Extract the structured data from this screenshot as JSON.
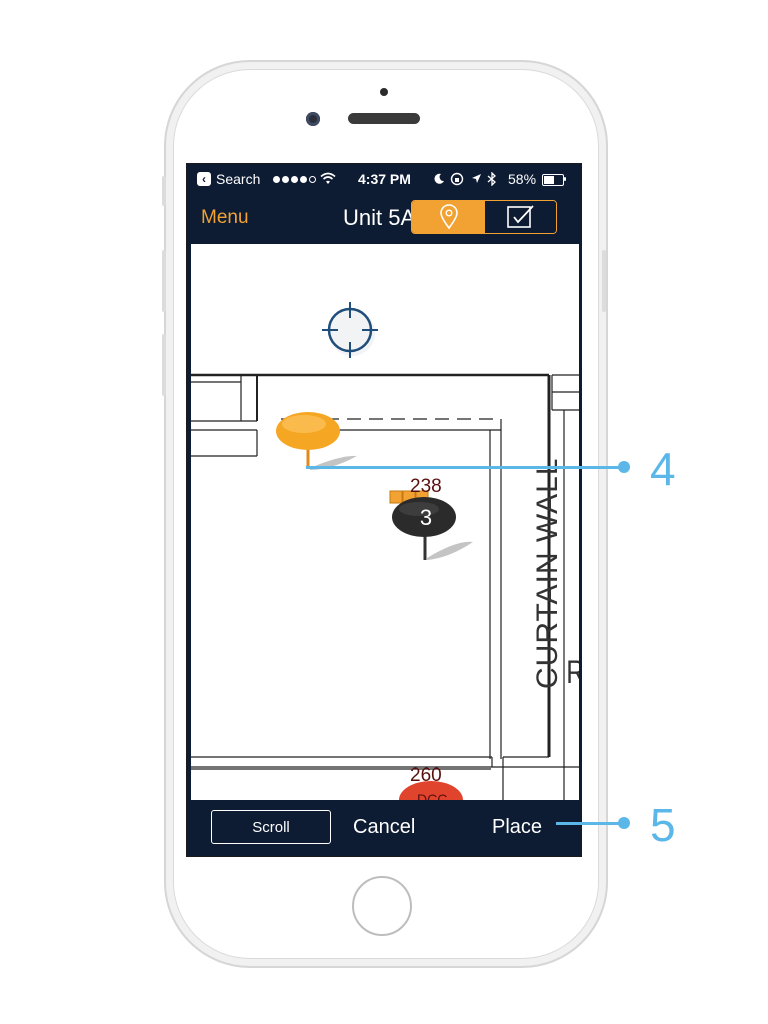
{
  "status_bar": {
    "back_label": "Search",
    "time": "4:37 PM",
    "battery": "58%",
    "battery_level": 0.58
  },
  "nav": {
    "menu_label": "Menu",
    "title": "Unit 5A",
    "mode_left_icon": "location-pin-icon",
    "mode_right_icon": "checkbox-icon",
    "mode_active": "pin"
  },
  "map": {
    "wall_label": "CURTAIN WALL",
    "partial_label": "R",
    "pins": [
      {
        "name": "new-pin",
        "color": "#f5a623"
      },
      {
        "name": "pin-3",
        "number": "3",
        "label": "238",
        "color": "#2b2b2b"
      },
      {
        "name": "pin-260",
        "label": "260",
        "partial_text": "DCC",
        "color": "#e0442c"
      }
    ],
    "target_icon": "crosshair-icon"
  },
  "bottom_bar": {
    "scroll_label": "Scroll",
    "cancel_label": "Cancel",
    "place_label": "Place"
  },
  "callouts": {
    "first": "4",
    "second": "5"
  },
  "colors": {
    "navy": "#0d1b33",
    "orange": "#f2a232",
    "callout_blue": "#5ab7e8"
  }
}
